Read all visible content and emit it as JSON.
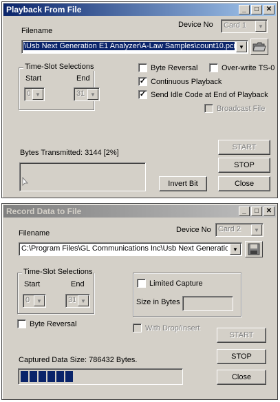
{
  "playback": {
    "title": "Playback From File",
    "title_buttons": [
      "_",
      "□",
      "✕"
    ],
    "filename_label": "Filename",
    "filename_value": "\\Usb Next Generation E1 Analyzer\\A-Law Samples\\count10.pcm",
    "device_label": "Device No",
    "device_value": "Card 1",
    "timeslot_group": "Time-Slot Selections",
    "start_label": "Start",
    "end_label": "End",
    "start_value": "0",
    "end_value": "31",
    "byte_reversal": "Byte Reversal",
    "overwrite": "Over-write TS-0",
    "continuous": "Continuous Playback",
    "send_idle": "Send Idle Code at End of Playback",
    "broadcast": "Broadcast File",
    "bytes_transmitted": "Bytes Transmitted: 3144 [2%]",
    "progress_percent": 2,
    "start_btn": "START",
    "stop_btn": "STOP",
    "invert_btn": "Invert Bit",
    "close_btn": "Close"
  },
  "record": {
    "title": "Record Data to File",
    "title_buttons": [
      "_",
      "□",
      "✕"
    ],
    "filename_label": "Filename",
    "filename_value": "C:\\Program Files\\GL Communications Inc\\Usb Next Generation",
    "device_label": "Device No",
    "device_value": "Card 2",
    "timeslot_group": "Time-Slot Selections",
    "start_label": "Start",
    "end_label": "End",
    "start_value": "0",
    "end_value": "31",
    "byte_reversal": "Byte Reversal",
    "limited_capture": "Limited Capture",
    "size_in_bytes": "Size in Bytes",
    "size_value": "",
    "with_drop_insert": "With Drop/Insert",
    "captured_size": "Captured Data Size: 786432 Bytes.",
    "progress_segments": 6,
    "start_btn": "START",
    "stop_btn": "STOP",
    "close_btn": "Close"
  },
  "colors": {
    "active_title": "#0a246a",
    "inactive_title": "#808080",
    "face": "#d4d0c8",
    "progress": "#0a246a"
  }
}
